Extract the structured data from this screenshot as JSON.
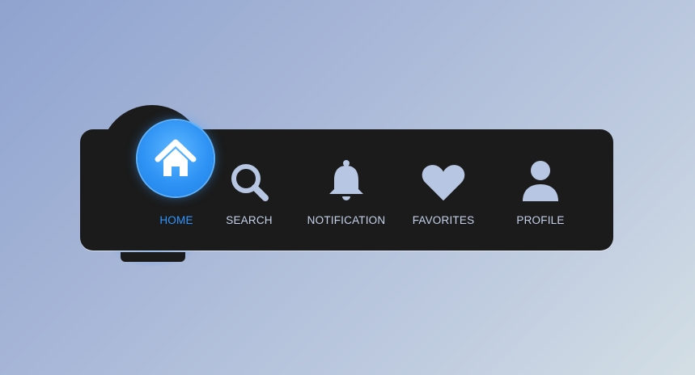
{
  "nav": {
    "active": "home",
    "items": [
      {
        "id": "home",
        "label": "HOME",
        "icon": "home-icon"
      },
      {
        "id": "search",
        "label": "SEARCH",
        "icon": "search-icon"
      },
      {
        "id": "notification",
        "label": "NOTIFICATION",
        "icon": "bell-icon"
      },
      {
        "id": "favorites",
        "label": "FAVORITES",
        "icon": "heart-icon"
      },
      {
        "id": "profile",
        "label": "PROFILE",
        "icon": "user-icon"
      }
    ]
  },
  "colors": {
    "accent": "#2f96ff",
    "bar": "#1b1b1b",
    "icon": "#b7c6e2",
    "label": "#c5d2ea"
  }
}
